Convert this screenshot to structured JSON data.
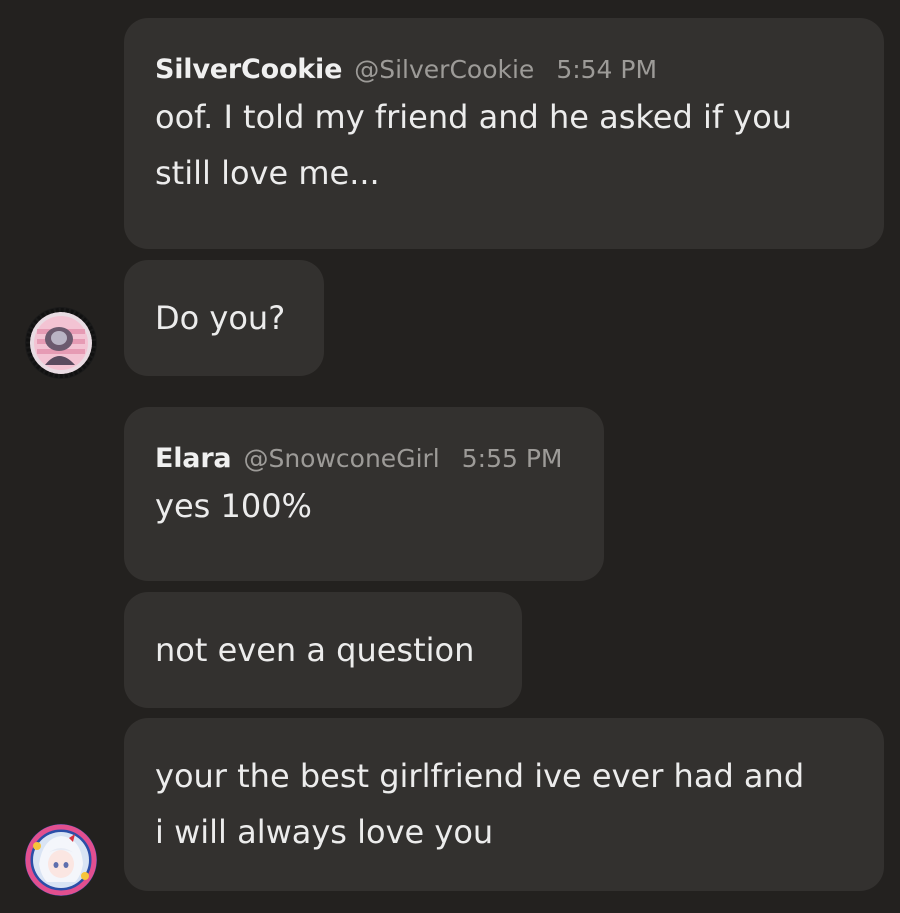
{
  "messages": [
    {
      "author": "SilverCookie",
      "handle": "@SilverCookie",
      "time": "5:54 PM",
      "lines": [
        "oof. I told my friend and he asked if you",
        "still love me..."
      ]
    },
    {
      "lines": [
        "Do you?"
      ]
    },
    {
      "author": "Elara",
      "handle": "@SnowconeGirl",
      "time": "5:55 PM",
      "lines": [
        "yes 100%"
      ]
    },
    {
      "lines": [
        "not even a question"
      ]
    },
    {
      "lines": [
        "your the best girlfriend ive ever had and",
        "i will always love you"
      ]
    }
  ],
  "avatars": {
    "silvercookie": "avatar-silvercookie",
    "elara": "avatar-elara"
  },
  "colors": {
    "background": "#23211f",
    "bubble": "#33312f",
    "text": "#ececec",
    "muted": "#9d9b98"
  }
}
